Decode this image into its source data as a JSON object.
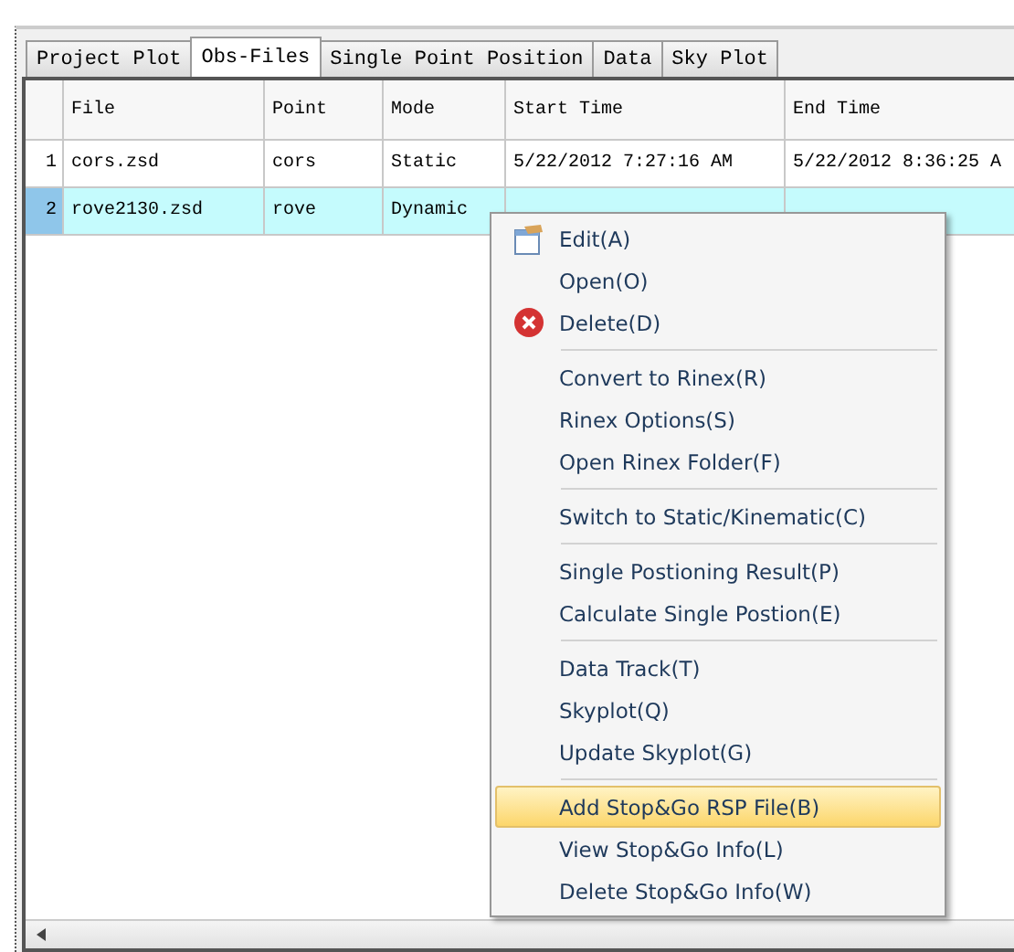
{
  "tabs": [
    {
      "label": "Project Plot",
      "selected": false
    },
    {
      "label": "Obs-Files",
      "selected": true
    },
    {
      "label": "Single Point Position",
      "selected": false
    },
    {
      "label": "Data",
      "selected": false
    },
    {
      "label": "Sky Plot",
      "selected": false
    }
  ],
  "table": {
    "columns": [
      "File",
      "Point",
      "Mode",
      "Start Time",
      "End Time"
    ],
    "rows": [
      {
        "number": "1",
        "selected": false,
        "cells": [
          "cors.zsd",
          "cors",
          "Static",
          "5/22/2012 7:27:16 AM",
          "5/22/2012 8:36:25 A"
        ]
      },
      {
        "number": "2",
        "selected": true,
        "cells": [
          "rove2130.zsd",
          "rove",
          "Dynamic"
        ]
      }
    ]
  },
  "context_menu": {
    "groups": [
      [
        {
          "label": "Edit(A)",
          "kind": "edit",
          "selected": false
        },
        {
          "label": "Open(O)",
          "kind": "plain",
          "selected": false
        },
        {
          "label": "Delete(D)",
          "kind": "delete",
          "selected": false
        }
      ],
      [
        {
          "label": "Convert to Rinex(R)",
          "kind": "plain",
          "selected": false
        },
        {
          "label": "Rinex Options(S)",
          "kind": "plain",
          "selected": false
        },
        {
          "label": "Open Rinex Folder(F)",
          "kind": "plain",
          "selected": false
        }
      ],
      [
        {
          "label": "Switch to Static/Kinematic(C)",
          "kind": "plain",
          "selected": false
        }
      ],
      [
        {
          "label": "Single Postioning Result(P)",
          "kind": "plain",
          "selected": false
        },
        {
          "label": "Calculate Single Postion(E)",
          "kind": "plain",
          "selected": false
        }
      ],
      [
        {
          "label": "Data Track(T)",
          "kind": "plain",
          "selected": false
        },
        {
          "label": "Skyplot(Q)",
          "kind": "plain",
          "selected": false
        },
        {
          "label": "Update Skyplot(G)",
          "kind": "plain",
          "selected": false
        }
      ],
      [
        {
          "label": "Add Stop&Go RSP File(B)",
          "kind": "plain",
          "selected": true
        },
        {
          "label": "View Stop&Go Info(L)",
          "kind": "plain",
          "selected": false
        },
        {
          "label": "Delete Stop&Go Info(W)",
          "kind": "plain",
          "selected": false
        }
      ]
    ]
  }
}
